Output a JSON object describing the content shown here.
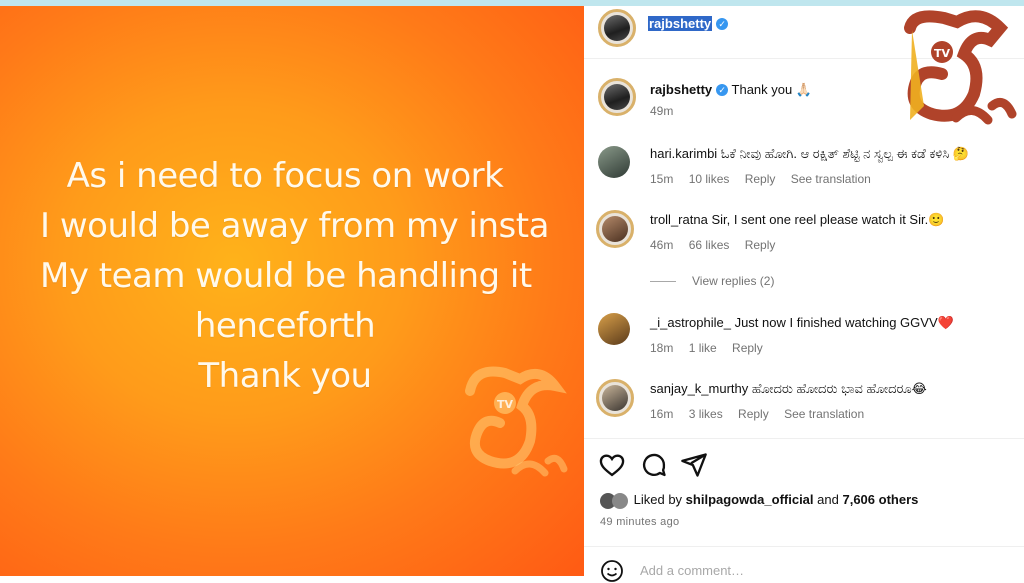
{
  "story": {
    "lines": [
      "As i need to focus on work",
      "I would be away from my insta",
      "My team would be handling it",
      "henceforth",
      "Thank you"
    ]
  },
  "watermark": {
    "text": "TV"
  },
  "post": {
    "username": "rajbshetty",
    "caption": {
      "user": "rajbshetty",
      "text": "Thank you 🙏🏻",
      "time": "49m"
    }
  },
  "comments": [
    {
      "user": "hari.karimbi",
      "text": "ಓಕೆ ನೀವು ಹೋಗಿ. ಆ ರಕ್ಷಿತ್ ಶೆಟ್ಟಿ ನ ಸ್ವಲ್ಪ ಈ ಕಡೆ ಕಳಿಸಿ 🤔",
      "time": "15m",
      "likes": "10 likes",
      "reply": "Reply",
      "translate": "See translation"
    },
    {
      "user": "troll_ratna",
      "text": "Sir, I sent one reel please watch it Sir.🙂",
      "time": "46m",
      "likes": "66 likes",
      "reply": "Reply",
      "translate": ""
    },
    {
      "user": "_i_astrophile_",
      "text": "Just now I finished watching GGVV❤️",
      "time": "18m",
      "likes": "1 like",
      "reply": "Reply",
      "translate": ""
    },
    {
      "user": "sanjay_k_murthy",
      "text": "ಹೋದರು ಹೋದರು ಭಾವ ಹೋದರೂ😂",
      "time": "16m",
      "likes": "3 likes",
      "reply": "Reply",
      "translate": "See translation"
    }
  ],
  "view_replies": "View replies (2)",
  "liked_by": {
    "prefix": "Liked by",
    "user": "shilpagowda_official",
    "and": "and",
    "others": "7,606 others"
  },
  "posted_ago": "49 minutes ago",
  "add_comment_placeholder": "Add a comment…",
  "colors": {
    "accent": "#3797f0",
    "story_bg": "#ff8c1a",
    "logo": "#b0432a"
  }
}
